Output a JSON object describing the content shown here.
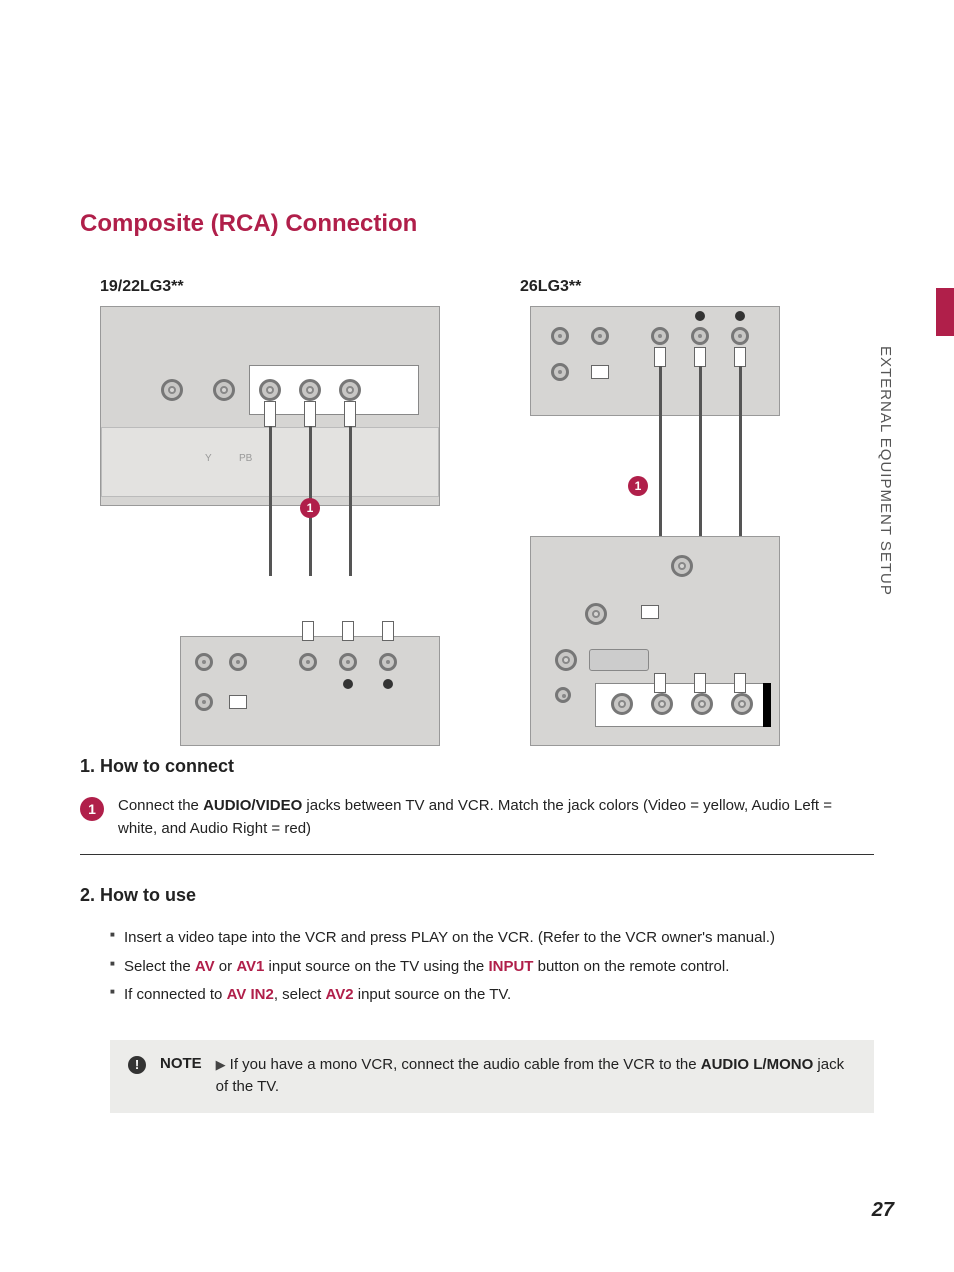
{
  "title": "Composite (RCA) Connection",
  "side_label": "EXTERNAL EQUIPMENT SETUP",
  "diagrams": {
    "left_label": "19/22LG3**",
    "right_label": "26LG3**",
    "cable_badge": "1",
    "component_labels": {
      "y": "Y",
      "pb": "PB"
    }
  },
  "section1": {
    "heading": "1. How to connect",
    "step_num": "1",
    "step_text_parts": {
      "pre": "Connect the ",
      "bold": "AUDIO/VIDEO",
      "post": " jacks between TV and VCR. Match the jack colors (Video = yellow, Audio Left = white, and Audio Right = red)"
    }
  },
  "section2": {
    "heading": "2. How to use",
    "bullet1": "Insert a video tape into the VCR and press PLAY on the VCR. (Refer to the VCR owner's manual.)",
    "bullet2": {
      "p1": "Select the ",
      "h1": "AV",
      "p2": " or ",
      "h2": "AV1",
      "p3": " input source on the TV using the ",
      "h3": "INPUT",
      "p4": " button on the remote control."
    },
    "bullet3": {
      "p1": "If connected to ",
      "h1": "AV IN2",
      "p2": ", select ",
      "h2": "AV2",
      "p3": " input source on the TV."
    }
  },
  "note": {
    "label": "NOTE",
    "arrow": "▶",
    "text_pre": "If you have a mono VCR, connect the audio cable from the VCR to the ",
    "text_bold": "AUDIO L/MONO",
    "text_post": " jack of the TV."
  },
  "page_number": "27"
}
